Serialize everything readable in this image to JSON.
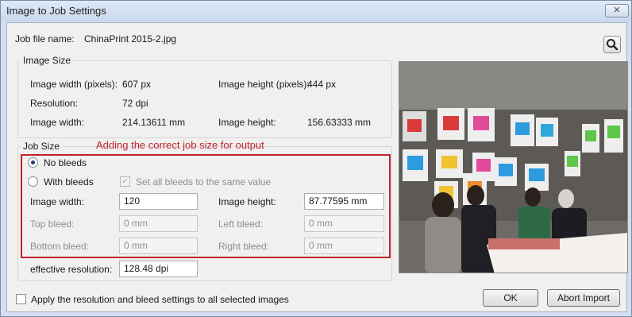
{
  "window": {
    "title": "Image to Job Settings",
    "close_glyph": "✕"
  },
  "job_file": {
    "label": "Job file name:",
    "value": "ChinaPrint 2015-2.jpg"
  },
  "image_size": {
    "group_label": "Image Size",
    "width_px_label": "Image width (pixels):",
    "width_px_value": "607 px",
    "height_px_label": "Image height (pixels):",
    "height_px_value": "444 px",
    "resolution_label": "Resolution:",
    "resolution_value": "72 dpi",
    "width_label": "Image width:",
    "width_value": "214.13611 mm",
    "height_label": "Image height:",
    "height_value": "156.63333 mm"
  },
  "job_size": {
    "group_label": "Job Size",
    "annotation": "Adding the correct job size for output",
    "annotation_color": "#c0242b",
    "no_bleeds_label": "No bleeds",
    "no_bleeds_selected": true,
    "with_bleeds_label": "With bleeds",
    "same_bleeds_label": "Set all bleeds to the same value",
    "same_bleeds_checked": true,
    "image_width_label": "Image width:",
    "image_width_value": "120",
    "image_height_label": "Image height:",
    "image_height_value": "87.77595 mm",
    "top_bleed_label": "Top bleed:",
    "top_bleed_value": "0 mm",
    "left_bleed_label": "Left bleed:",
    "left_bleed_value": "0 mm",
    "bottom_bleed_label": "Bottom bleed:",
    "bottom_bleed_value": "0 mm",
    "right_bleed_label": "Right bleed:",
    "right_bleed_value": "0 mm",
    "effective_resolution_label": "effective resolution:",
    "effective_resolution_value": "128.48 dpi"
  },
  "footer": {
    "apply_all_label": "Apply the resolution and bleed settings to all selected images",
    "apply_all_checked": false,
    "ok_label": "OK",
    "abort_label": "Abort Import"
  },
  "icons": {
    "search": "magnifier-icon",
    "close": "close-icon"
  }
}
